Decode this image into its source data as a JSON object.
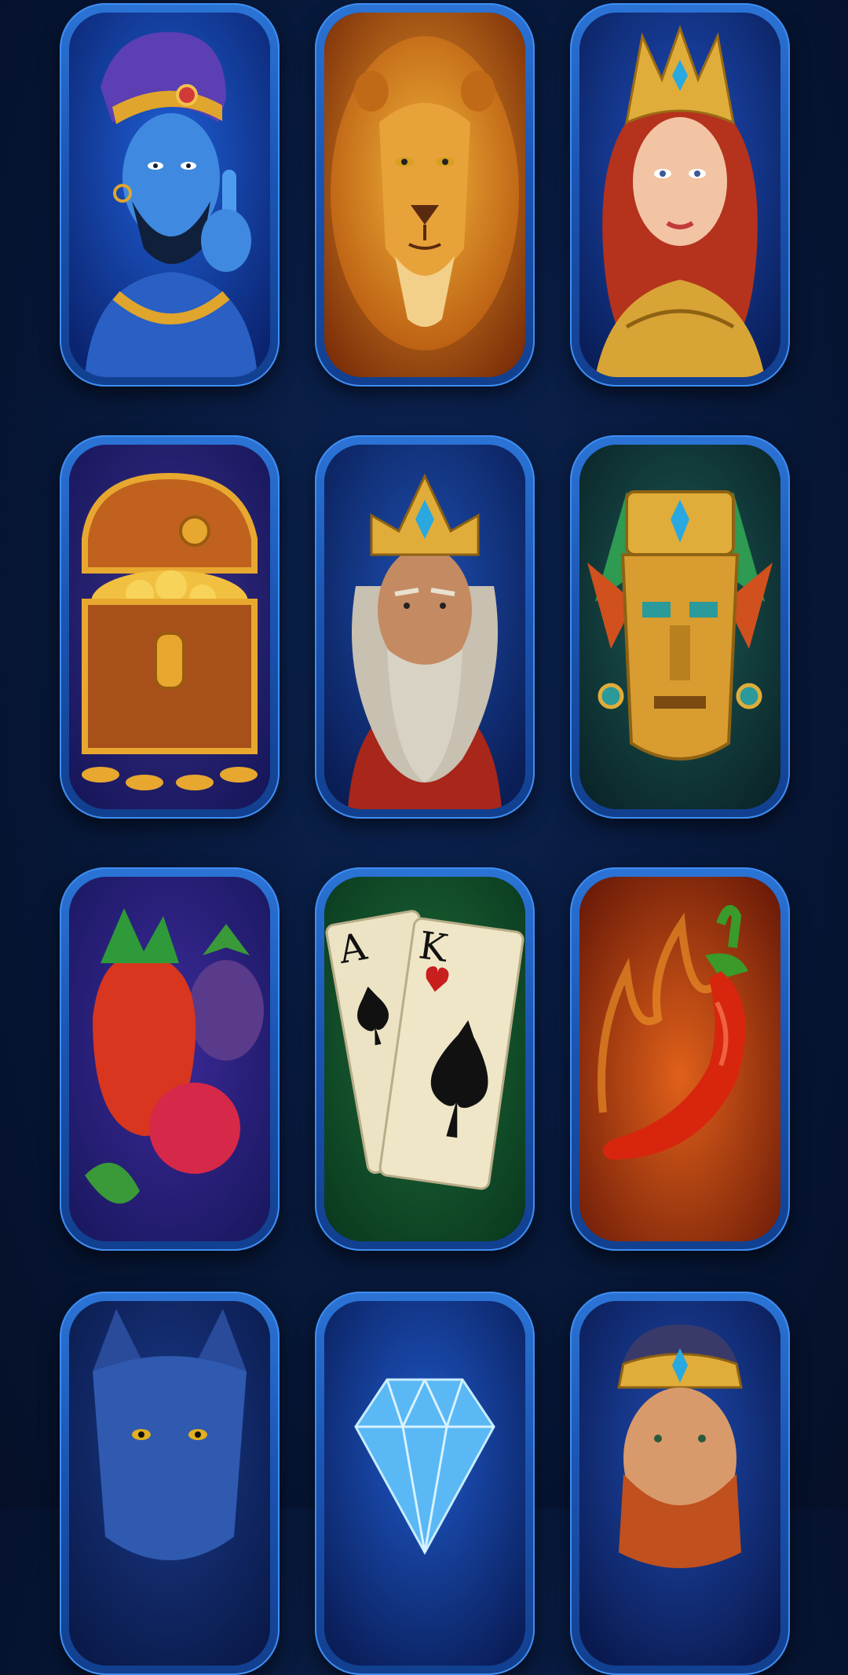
{
  "grid": {
    "tiles": [
      {
        "icon": "genie-icon"
      },
      {
        "icon": "lion-icon"
      },
      {
        "icon": "warrior-queen-icon"
      },
      {
        "icon": "treasure-chest-icon"
      },
      {
        "icon": "king-icon"
      },
      {
        "icon": "aztec-mask-icon"
      },
      {
        "icon": "berries-icon"
      },
      {
        "icon": "playing-cards-icon"
      },
      {
        "icon": "chili-pepper-icon"
      },
      {
        "icon": "wolf-icon"
      },
      {
        "icon": "diamond-icon"
      },
      {
        "icon": "dwarf-icon"
      }
    ],
    "cards": {
      "ace": "A",
      "king": "K"
    }
  },
  "colors": {
    "background": "#071839",
    "frame": "#1b55b3",
    "frame_highlight": "#3f8df0"
  }
}
